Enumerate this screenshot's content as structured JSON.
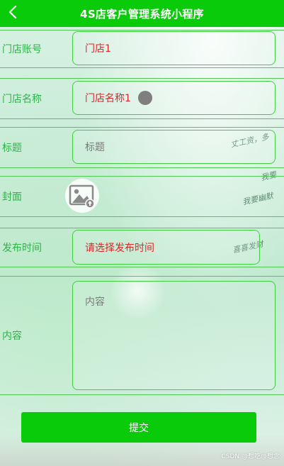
{
  "header": {
    "title": "4S店客户管理系统小程序",
    "back_icon": "chevron-left-icon",
    "background": "#0acb0a"
  },
  "form": {
    "store_account": {
      "label": "门店账号",
      "value": "门店1"
    },
    "store_name": {
      "label": "门店名称",
      "value": "门店名称1"
    },
    "title": {
      "label": "标题",
      "placeholder": "标题"
    },
    "cover": {
      "label": "封面",
      "icon": "image-upload-icon"
    },
    "publish_time": {
      "label": "发布时间",
      "placeholder": "请选择发布时间"
    },
    "content": {
      "label": "内容",
      "placeholder": "内容"
    },
    "submit_label": "提交"
  },
  "decoration": {
    "handwriting": [
      "丈工资，多",
      "我要",
      "我要幽默",
      "喜喜发财"
    ]
  },
  "watermark": "CSDN @想吃@想念",
  "colors": {
    "accent_green": "#0acb0a",
    "label_green": "#2fb34a",
    "value_red": "#e0262a",
    "placeholder_gray": "#7a7a7a"
  }
}
